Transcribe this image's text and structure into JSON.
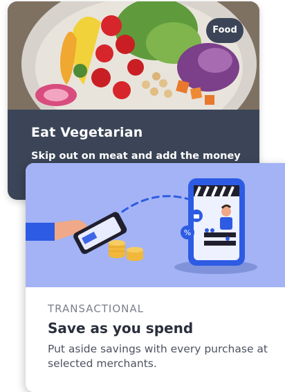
{
  "cards": [
    {
      "category_badge": "Food",
      "title": "Eat Vegetarian",
      "description": "Skip out on meat and add the money"
    },
    {
      "category": "TRANSACTIONAL",
      "title": "Save as you spend",
      "description": "Put aside savings with every purchase at selected merchants."
    }
  ],
  "colors": {
    "back_card_bg": "#3b4557",
    "illustration_bg": "#a3b3f5",
    "accent_blue": "#2d5be3"
  }
}
